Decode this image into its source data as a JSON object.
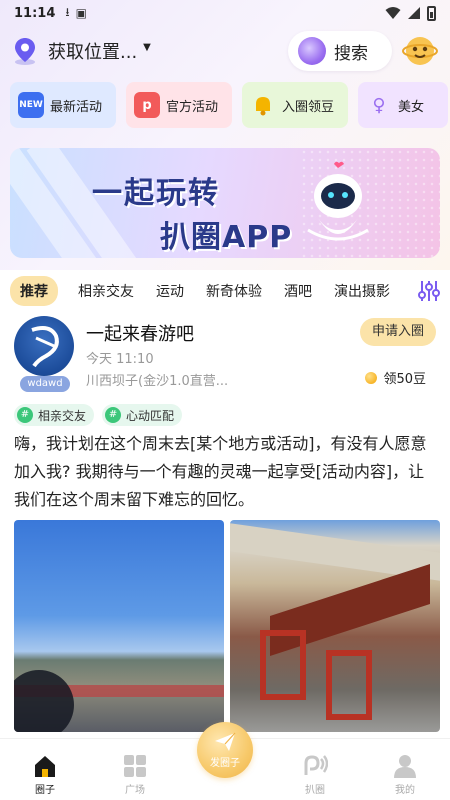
{
  "status_bar": {
    "time": "11:14"
  },
  "header": {
    "location": "获取位置...",
    "search_label": "搜索"
  },
  "categories": [
    {
      "label": "最新活动",
      "icon": "new-icon"
    },
    {
      "label": "官方活动",
      "icon": "megaphone-icon"
    },
    {
      "label": "入圈领豆",
      "icon": "bell-icon"
    },
    {
      "label": "美女",
      "icon": "woman-icon"
    }
  ],
  "banner": {
    "line1": "一起玩转",
    "line2": "扒圈APP"
  },
  "tabs": [
    "推荐",
    "相亲交友",
    "运动",
    "新奇体验",
    "酒吧",
    "演出摄影"
  ],
  "post": {
    "title": "一起来春游吧",
    "time": "今天 11:10",
    "location": "川西坝子(金沙1.0直营...",
    "avatar_tag": "wdawd",
    "join_label": "申请入圈",
    "beans": "领50豆",
    "tags": [
      "相亲交友",
      "心动匹配"
    ],
    "body": "嗨，我计划在这个周末去[某个地方或活动]，有没有人愿意加入我? 我期待与一个有趣的灵魂一起享受[活动内容]，让我们在这个周末留下难忘的回忆。"
  },
  "bottom_nav": {
    "items": [
      "圈子",
      "广场",
      "扒圈",
      "我的"
    ],
    "publish_label": "发圈子"
  },
  "colors": {
    "accent_yellow": "#fbe3a9",
    "tag_green": "#3cc77a",
    "brand_purple": "#9b6ff0"
  }
}
